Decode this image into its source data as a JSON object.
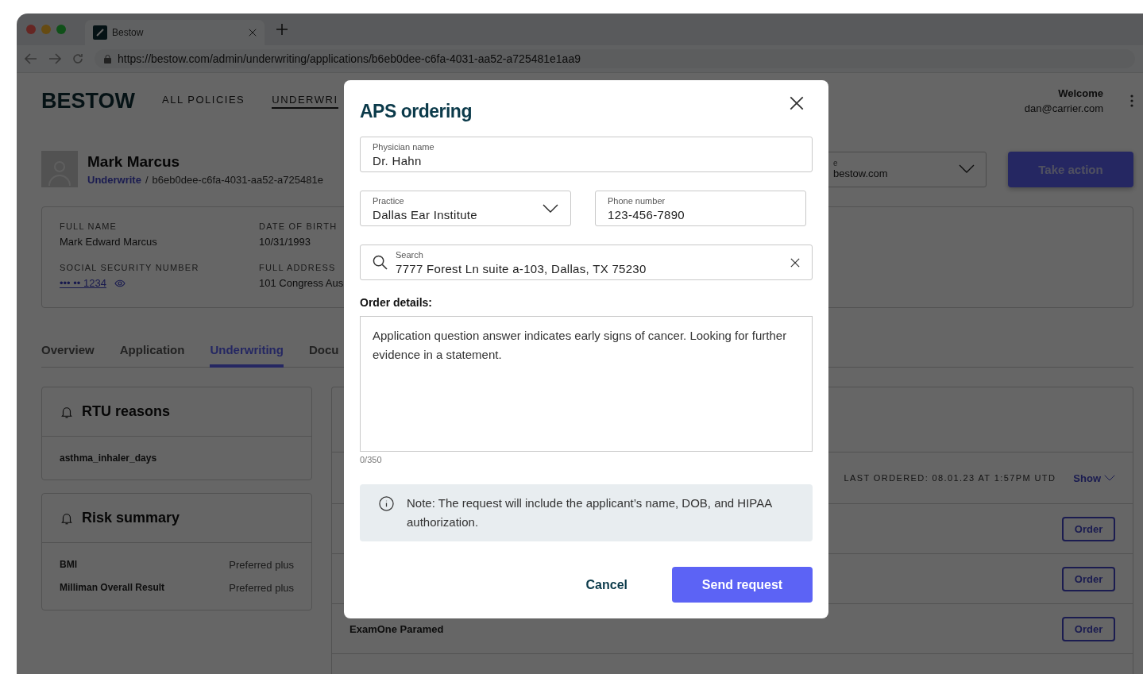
{
  "browser": {
    "tab_title": "Bestow",
    "url": "https://bestow.com/admin/underwriting/applications/b6eb0dee-c6fa-4031-aa52-a725481e1aa9"
  },
  "header": {
    "logo": "BESTOW",
    "nav": [
      {
        "label": "ALL POLICIES",
        "selected": false
      },
      {
        "label": "UNDERWRI",
        "selected": true
      }
    ],
    "welcome": "Welcome",
    "email": "dan@carrier.com"
  },
  "profile": {
    "name": "Mark Marcus",
    "breadcrumb_link": "Underwrite",
    "breadcrumb_separator": "/",
    "breadcrumb_id": "b6eb0dee-c6fa-4031-aa52-a725481e",
    "assignee_label": "e",
    "assignee_value": "bestow.com",
    "action_button": "Take action"
  },
  "info": {
    "fields": [
      {
        "label": "FULL NAME",
        "value": "Mark Edward Marcus",
        "kind": "text"
      },
      {
        "label": "DATE OF BIRTH",
        "value": "10/31/1993",
        "kind": "text"
      },
      {
        "label": "SOCIAL SECURITY NUMBER",
        "value": "••• •• 1234",
        "kind": "masked"
      },
      {
        "label": "FULL ADDRESS",
        "value": "101 Congress Aus",
        "kind": "text"
      }
    ]
  },
  "tabs": [
    {
      "label": "Overview",
      "selected": false
    },
    {
      "label": "Application",
      "selected": false
    },
    {
      "label": "Underwriting",
      "selected": true
    },
    {
      "label": "Docu",
      "selected": false
    }
  ],
  "rtu": {
    "title": "RTU reasons",
    "items": [
      "asthma_inhaler_days"
    ]
  },
  "risk": {
    "title": "Risk summary",
    "rows": [
      {
        "label": "BMI",
        "value": "Preferred plus"
      },
      {
        "label": "Milliman Overall Result",
        "value": "Preferred plus"
      }
    ]
  },
  "orders": {
    "last_ordered": "LAST ORDERED: 08.01.23 AT 1:57PM UTD",
    "show": "Show",
    "rows": [
      {
        "button": "Order"
      },
      {
        "button": "Order"
      },
      {
        "name": "ExamOne Paramed",
        "button": "Order"
      }
    ]
  },
  "modal": {
    "title": "APS ordering",
    "physician": {
      "label": "Physician name",
      "value": "Dr. Hahn"
    },
    "practice": {
      "label": "Practice",
      "value": "Dallas Ear Institute"
    },
    "phone": {
      "label": "Phone number",
      "value": "123-456-7890"
    },
    "search": {
      "label": "Search",
      "value": "7777 Forest Ln suite a-103, Dallas, TX 75230"
    },
    "details_label": "Order details:",
    "details": "Application question answer indicates early signs of cancer. Looking for further evidence in a statement.",
    "counter": "0/350",
    "note": "Note: The request will include the applicant’s name, DOB, and HIPAA authorization.",
    "cancel": "Cancel",
    "send": "Send request"
  }
}
